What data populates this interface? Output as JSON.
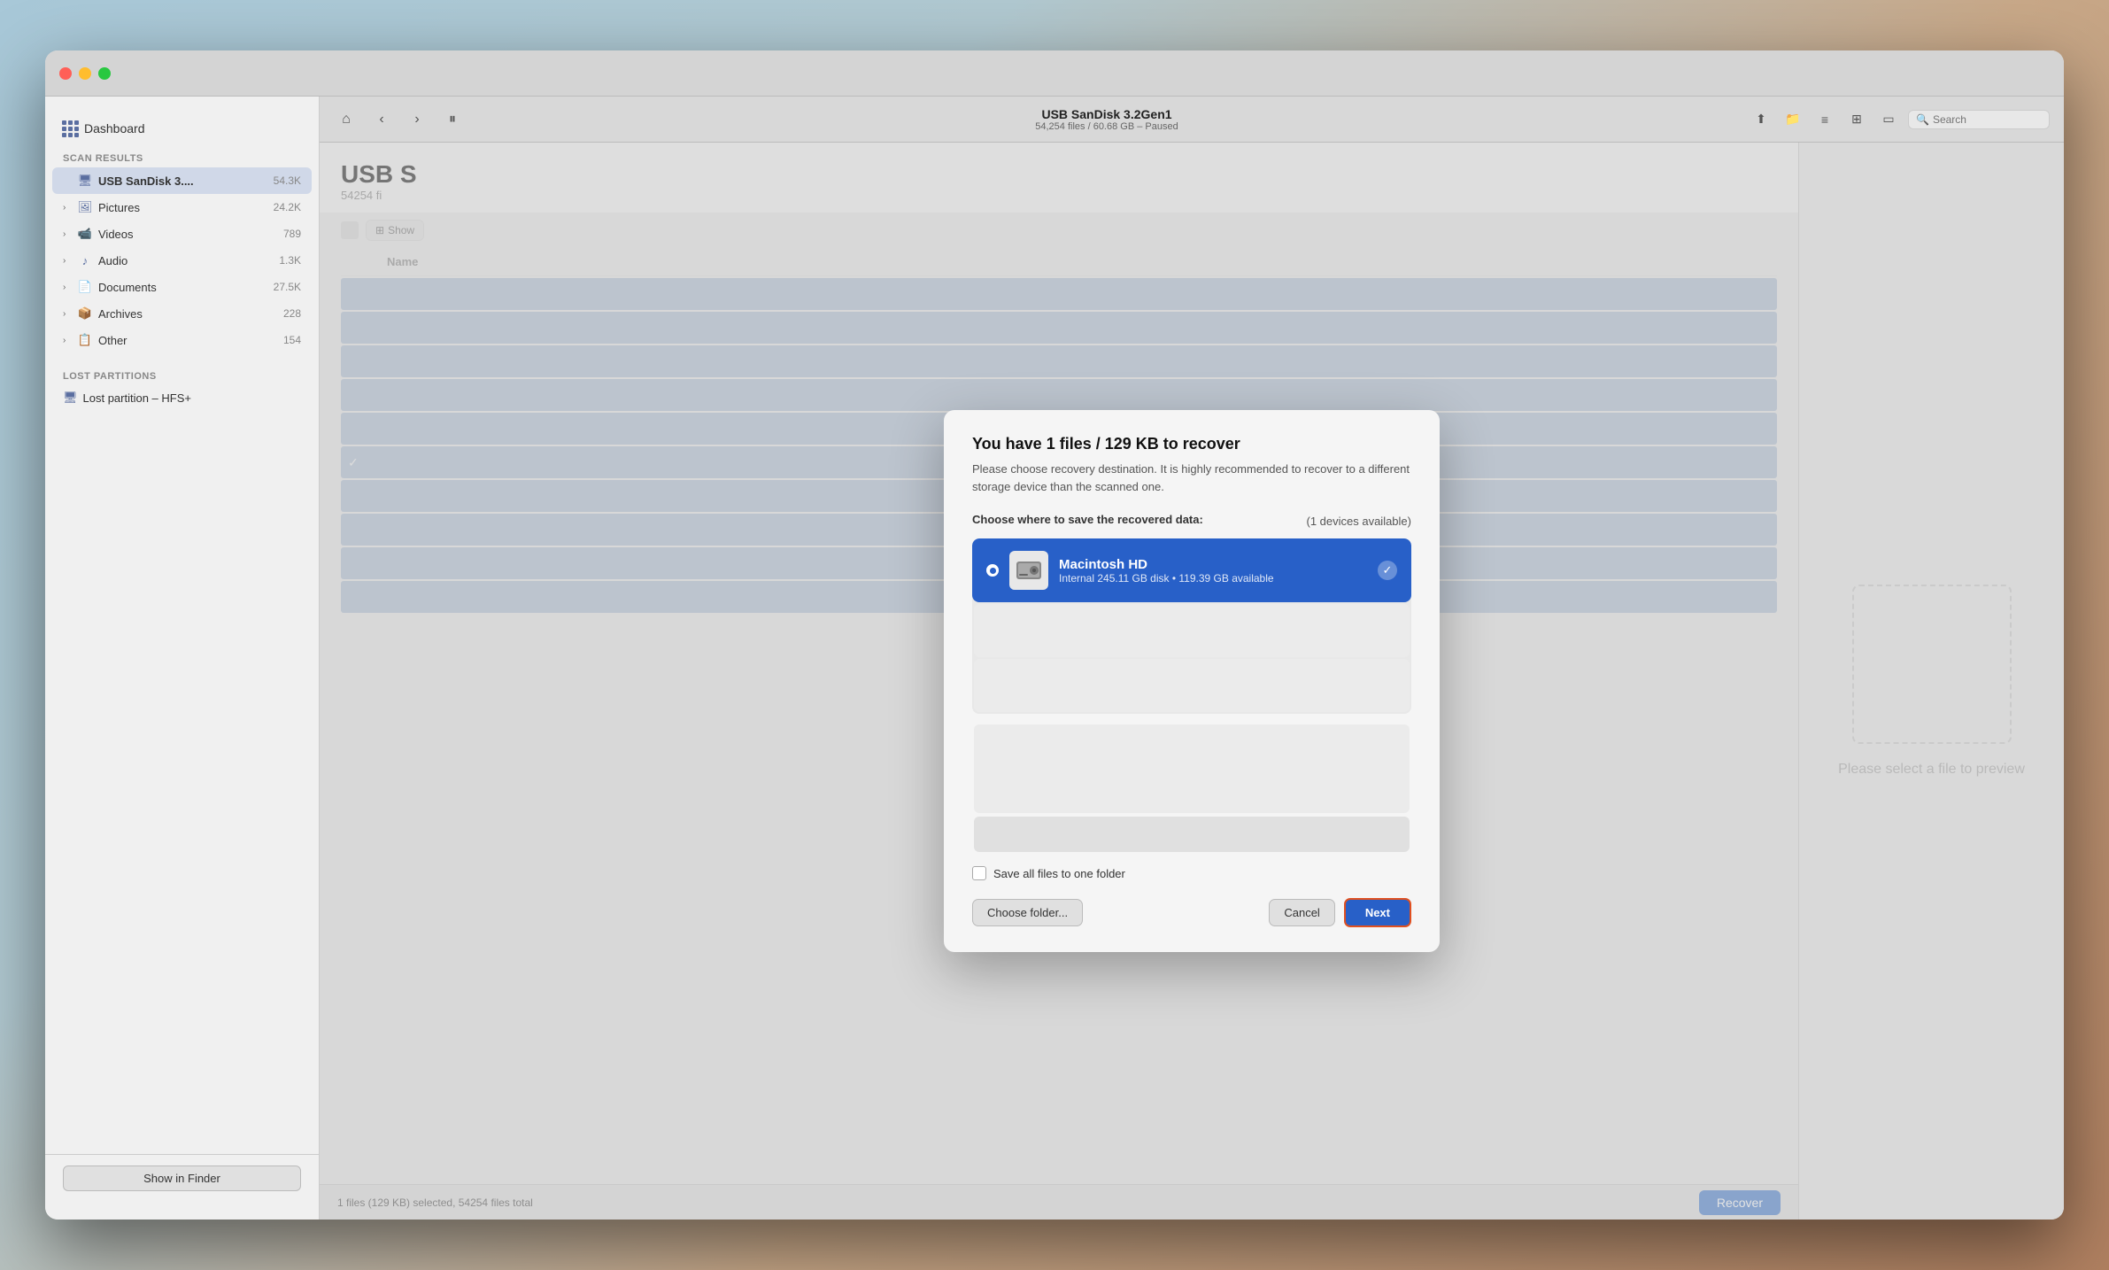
{
  "window": {
    "title": "USB SanDisk 3.2Gen1",
    "subtitle": "54,254 files / 60.68 GB – Paused"
  },
  "sidebar": {
    "dashboard_label": "Dashboard",
    "scan_results_label": "Scan results",
    "items": [
      {
        "name": "USB SanDisk 3....",
        "count": "54.3K",
        "active": true,
        "icon": "drive"
      },
      {
        "name": "Pictures",
        "count": "24.2K",
        "active": false,
        "icon": "picture"
      },
      {
        "name": "Videos",
        "count": "789",
        "active": false,
        "icon": "video"
      },
      {
        "name": "Audio",
        "count": "1.3K",
        "active": false,
        "icon": "audio"
      },
      {
        "name": "Documents",
        "count": "27.5K",
        "active": false,
        "icon": "document"
      },
      {
        "name": "Archives",
        "count": "228",
        "active": false,
        "icon": "archive"
      },
      {
        "name": "Other",
        "count": "154",
        "active": false,
        "icon": "other"
      }
    ],
    "lost_partitions_label": "Lost partitions",
    "lost_partitions": [
      {
        "name": "Lost partition – HFS+",
        "icon": "drive"
      }
    ],
    "show_finder_label": "Show in Finder"
  },
  "toolbar": {
    "title": "USB SanDisk 3.2Gen1",
    "subtitle": "54,254 files / 60.68 GB – Paused",
    "search_placeholder": "Search"
  },
  "content": {
    "title": "USB S",
    "subtitle": "54254 fi",
    "filter_label": "Show",
    "table_col_name": "Name"
  },
  "status_bar": {
    "text": "1 files (129 KB) selected, 54254 files total",
    "recover_label": "Recover"
  },
  "preview": {
    "text": "Please select a file to preview"
  },
  "dialog": {
    "title": "You have 1 files / 129 KB to recover",
    "subtitle": "Please choose recovery destination. It is highly recommended to recover to a different storage device than the scanned one.",
    "section_label": "Choose where to save the recovered data:",
    "devices_count": "(1 devices available)",
    "device": {
      "name": "Macintosh HD",
      "details": "Internal 245.11 GB disk • 119.39 GB available"
    },
    "checkbox_label": "Save all files to one folder",
    "choose_folder_label": "Choose folder...",
    "cancel_label": "Cancel",
    "next_label": "Next"
  }
}
